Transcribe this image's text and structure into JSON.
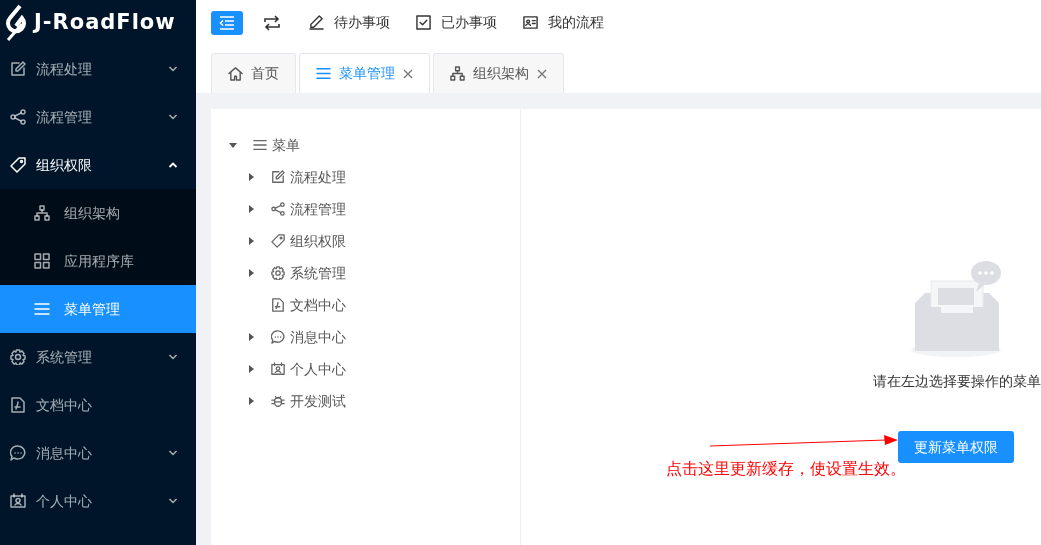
{
  "logo": {
    "text": "J-RoadFlow"
  },
  "toolbar": {
    "collapse_button": {
      "active": true
    },
    "links": [
      {
        "label": "待办事项"
      },
      {
        "label": "已办事项"
      },
      {
        "label": "我的流程"
      }
    ]
  },
  "sidebar": {
    "items": [
      {
        "label": "流程处理",
        "expanded": false,
        "selected": false,
        "has_children": true
      },
      {
        "label": "流程管理",
        "expanded": false,
        "selected": false,
        "has_children": true
      },
      {
        "label": "组织权限",
        "expanded": true,
        "selected": false,
        "has_children": true,
        "children": [
          {
            "label": "组织架构",
            "selected": false
          },
          {
            "label": "应用程序库",
            "selected": false
          },
          {
            "label": "菜单管理",
            "selected": true
          }
        ]
      },
      {
        "label": "系统管理",
        "expanded": false,
        "selected": false,
        "has_children": true
      },
      {
        "label": "文档中心",
        "expanded": false,
        "selected": false,
        "has_children": false
      },
      {
        "label": "消息中心",
        "expanded": false,
        "selected": false,
        "has_children": true
      },
      {
        "label": "个人中心",
        "expanded": false,
        "selected": false,
        "has_children": true
      }
    ]
  },
  "tabs": [
    {
      "label": "首页",
      "selected": false,
      "closable": false
    },
    {
      "label": "菜单管理",
      "selected": true,
      "closable": true
    },
    {
      "label": "组织架构",
      "selected": false,
      "closable": true
    }
  ],
  "tree": {
    "root": {
      "label": "菜单",
      "expanded": true,
      "children": [
        {
          "label": "流程处理",
          "expanded": false,
          "has_children": true
        },
        {
          "label": "流程管理",
          "expanded": false,
          "has_children": true
        },
        {
          "label": "组织权限",
          "expanded": false,
          "has_children": true
        },
        {
          "label": "系统管理",
          "expanded": false,
          "has_children": true
        },
        {
          "label": "文档中心",
          "expanded": false,
          "has_children": false
        },
        {
          "label": "消息中心",
          "expanded": false,
          "has_children": true
        },
        {
          "label": "个人中心",
          "expanded": false,
          "has_children": true
        },
        {
          "label": "开发测试",
          "expanded": false,
          "has_children": true
        }
      ]
    }
  },
  "empty_state": {
    "message": "请在左边选择要操作的菜单"
  },
  "update_button": {
    "label": "更新菜单权限"
  },
  "annotation": {
    "text": "点击这里更新缓存，使设置生效。"
  }
}
